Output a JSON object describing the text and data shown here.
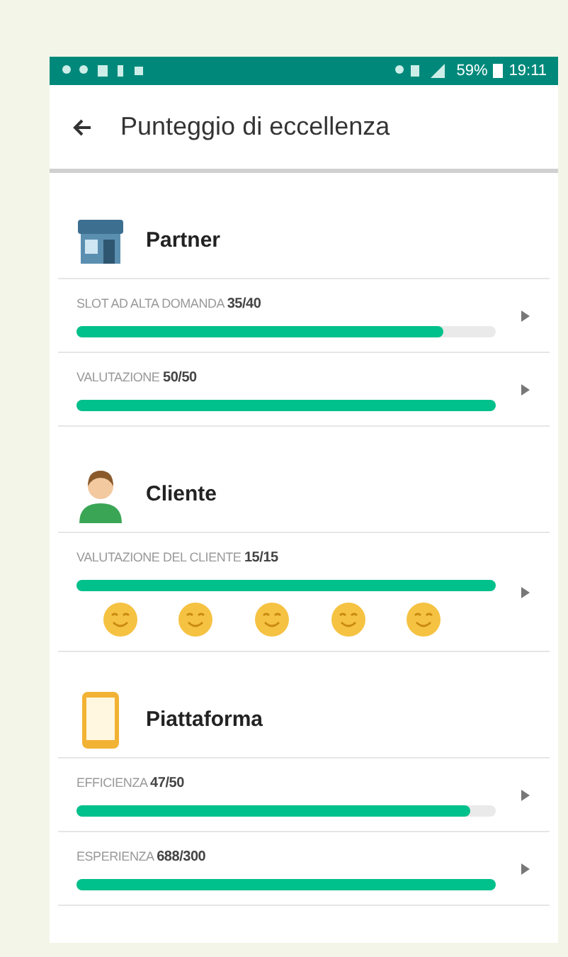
{
  "status_bar": {
    "battery": "59%",
    "time": "19:11"
  },
  "header": {
    "title": "Punteggio di eccellenza"
  },
  "sections": [
    {
      "title": "Partner",
      "kind": "store",
      "rows": [
        {
          "label": "SLOT AD ALTA DOMANDA",
          "score": "35/40",
          "level": 0.875
        },
        {
          "label": "VALUTAZIONE",
          "score": "50/50",
          "level": 1
        }
      ]
    },
    {
      "title": "Cliente",
      "kind": "person",
      "rows": [
        {
          "label": "VALUTAZIONE DEL CLIENTE",
          "score": "15/15",
          "level": 1,
          "stars": 5
        }
      ]
    },
    {
      "title": "Piattaforma",
      "kind": "phone",
      "rows": [
        {
          "label": "EFFICIENZA",
          "score": "47/50",
          "level": 0.94
        },
        {
          "label": "ESPERIENZA",
          "score": "688/300",
          "level": 1
        }
      ]
    }
  ]
}
